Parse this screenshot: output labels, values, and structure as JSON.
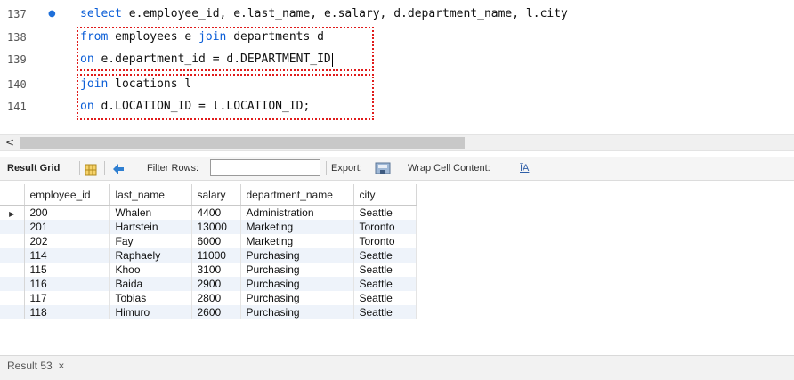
{
  "editor": {
    "lines": [
      {
        "num": "137",
        "marker": "●",
        "kw": "select",
        "text": " e.employee_id, e.last_name, e.salary, d.department_name, l.city"
      },
      {
        "num": "138",
        "marker": "",
        "kw": "from",
        "text": " employees e ",
        "kw2": "join",
        "text2": " departments d"
      },
      {
        "num": "139",
        "marker": "",
        "kw": "on",
        "text": " e.department_id = d.DEPARTMENT_ID"
      },
      {
        "num": "140",
        "marker": "",
        "kw": "join",
        "text": " locations l"
      },
      {
        "num": "141",
        "marker": "",
        "kw": "on",
        "text": " d.LOCATION_ID = l.LOCATION_ID;"
      }
    ]
  },
  "toolbar": {
    "result_grid_label": "Result Grid",
    "filter_rows_label": "Filter Rows:",
    "filter_value": "",
    "export_label": "Export:",
    "wrap_label": "Wrap Cell Content:",
    "wrap_icon": "ĪA"
  },
  "grid": {
    "columns": [
      "employee_id",
      "last_name",
      "salary",
      "department_name",
      "city"
    ],
    "rows": [
      [
        "200",
        "Whalen",
        "4400",
        "Administration",
        "Seattle"
      ],
      [
        "201",
        "Hartstein",
        "13000",
        "Marketing",
        "Toronto"
      ],
      [
        "202",
        "Fay",
        "6000",
        "Marketing",
        "Toronto"
      ],
      [
        "114",
        "Raphaely",
        "11000",
        "Purchasing",
        "Seattle"
      ],
      [
        "115",
        "Khoo",
        "3100",
        "Purchasing",
        "Seattle"
      ],
      [
        "116",
        "Baida",
        "2900",
        "Purchasing",
        "Seattle"
      ],
      [
        "117",
        "Tobias",
        "2800",
        "Purchasing",
        "Seattle"
      ],
      [
        "118",
        "Himuro",
        "2600",
        "Purchasing",
        "Seattle"
      ]
    ],
    "selected_row_marker": "▶"
  },
  "tabs": {
    "result_tab_label": "Result 53",
    "close_glyph": "×"
  },
  "scrollbar": {
    "left_arrow": "<"
  },
  "colors": {
    "keyword": "#0b5ed7",
    "highlight": "#e01b1b",
    "alt_row": "#eef3fa"
  }
}
